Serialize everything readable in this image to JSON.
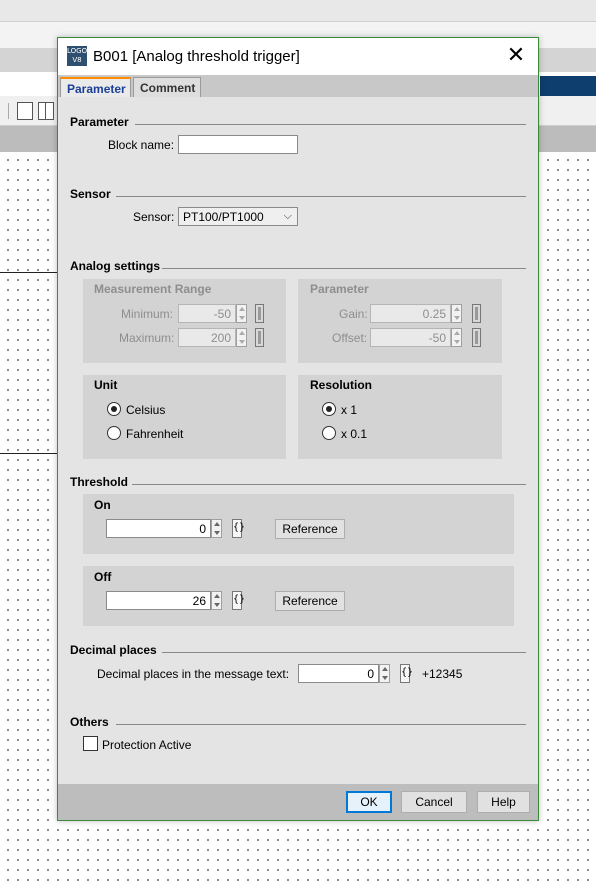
{
  "dialog": {
    "title": "B001 [Analog threshold trigger]",
    "icon_text": "LOGO V8",
    "close_symbol": "✕"
  },
  "tabs": [
    {
      "label": "Parameter",
      "active": true
    },
    {
      "label": "Comment",
      "active": false
    }
  ],
  "parameter": {
    "section": "Parameter",
    "block_name_label": "Block name:",
    "block_name_value": ""
  },
  "sensor": {
    "section": "Sensor",
    "label": "Sensor:",
    "value": "PT100/PT1000"
  },
  "analog": {
    "section": "Analog settings",
    "measurement": {
      "title": "Measurement Range",
      "min_label": "Minimum:",
      "min_value": "-50",
      "max_label": "Maximum:",
      "max_value": "200"
    },
    "param": {
      "title": "Parameter",
      "gain_label": "Gain:",
      "gain_value": "0.25",
      "offset_label": "Offset:",
      "offset_value": "-50"
    },
    "unit": {
      "title": "Unit",
      "options": [
        "Celsius",
        "Fahrenheit"
      ],
      "selected": "Celsius"
    },
    "resolution": {
      "title": "Resolution",
      "options": [
        "x 1",
        "x 0.1"
      ],
      "selected": "x 1"
    }
  },
  "threshold": {
    "section": "Threshold",
    "on": {
      "title": "On",
      "value": "0",
      "reference_label": "Reference"
    },
    "off": {
      "title": "Off",
      "value": "26",
      "reference_label": "Reference"
    },
    "brace_symbol": "{}"
  },
  "decimal": {
    "section": "Decimal places",
    "label": "Decimal places in the message text:",
    "value": "0",
    "preview": "+12345"
  },
  "others": {
    "section": "Others",
    "protection_label": "Protection Active",
    "protection_checked": false
  },
  "buttons": {
    "ok": "OK",
    "cancel": "Cancel",
    "help": "Help"
  }
}
